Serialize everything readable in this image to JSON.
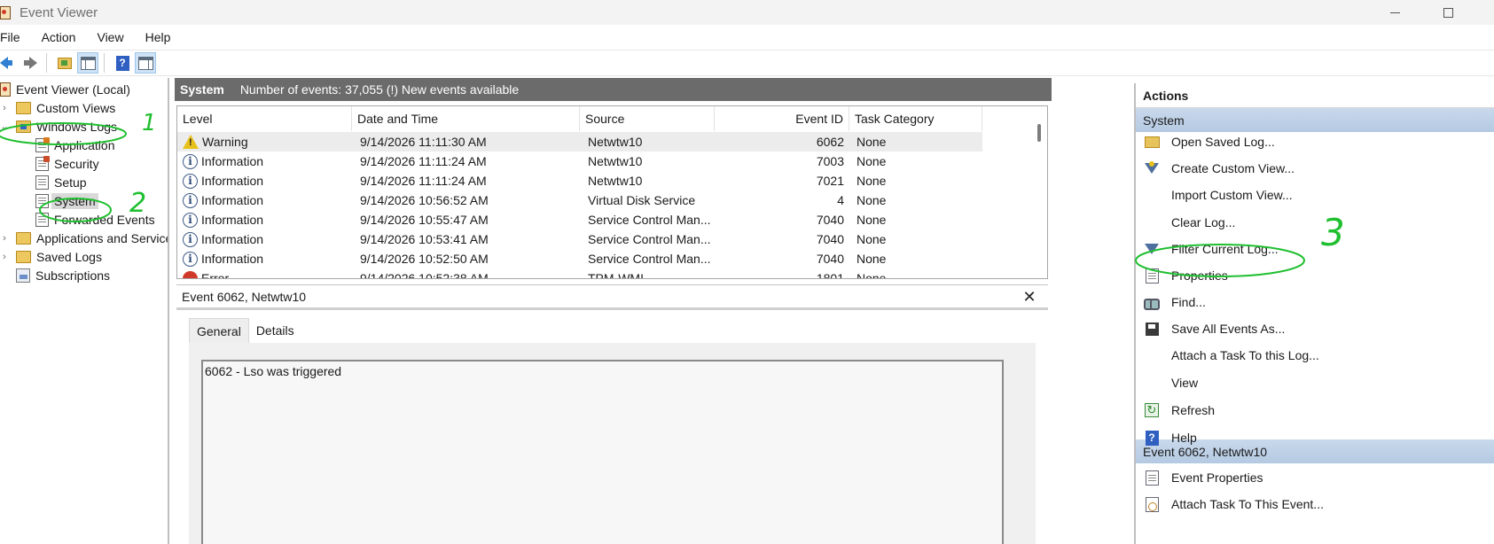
{
  "window": {
    "title": "Event Viewer"
  },
  "menu": [
    "File",
    "Action",
    "View",
    "Help"
  ],
  "toolbar": {
    "buttons": [
      "back-arrow-icon",
      "forward-arrow-icon",
      "folder-up-icon",
      "show-hide-console-tree-icon",
      "help-icon",
      "show-hide-action-pane-icon"
    ]
  },
  "tree": {
    "root": "Event Viewer (Local)",
    "custom_views": "Custom Views",
    "windows_logs": "Windows Logs",
    "application": "Application",
    "security": "Security",
    "setup": "Setup",
    "system": "System",
    "forwarded_events": "Forwarded Events",
    "apps_services": "Applications and Services",
    "saved_logs": "Saved Logs",
    "subscriptions": "Subscriptions",
    "selected": "System"
  },
  "log_header": {
    "log_name": "System",
    "summary": "Number of events: 37,055 (!) New events available"
  },
  "grid": {
    "columns": [
      "Level",
      "Date and Time",
      "Source",
      "Event ID",
      "Task Category"
    ],
    "rows": [
      {
        "level": "Warning",
        "icon": "warning-icon",
        "date": "9/14/2026 11:11:30 AM",
        "source": "Netwtw10",
        "id": "6062",
        "task": "None"
      },
      {
        "level": "Information",
        "icon": "info-icon",
        "date": "9/14/2026 11:11:24 AM",
        "source": "Netwtw10",
        "id": "7003",
        "task": "None"
      },
      {
        "level": "Information",
        "icon": "info-icon",
        "date": "9/14/2026 11:11:24 AM",
        "source": "Netwtw10",
        "id": "7021",
        "task": "None"
      },
      {
        "level": "Information",
        "icon": "info-icon",
        "date": "9/14/2026 10:56:52 AM",
        "source": "Virtual Disk Service",
        "id": "4",
        "task": "None"
      },
      {
        "level": "Information",
        "icon": "info-icon",
        "date": "9/14/2026 10:55:47 AM",
        "source": "Service Control Man...",
        "id": "7040",
        "task": "None"
      },
      {
        "level": "Information",
        "icon": "info-icon",
        "date": "9/14/2026 10:53:41 AM",
        "source": "Service Control Man...",
        "id": "7040",
        "task": "None"
      },
      {
        "level": "Information",
        "icon": "info-icon",
        "date": "9/14/2026 10:52:50 AM",
        "source": "Service Control Man...",
        "id": "7040",
        "task": "None"
      },
      {
        "level": "Error",
        "icon": "error-icon",
        "date": "9/14/2026 10:52:38 AM",
        "source": "TPM-WMI",
        "id": "1801",
        "task": "None"
      }
    ]
  },
  "detail": {
    "title": "Event 6062, Netwtw10",
    "tabs": [
      "General",
      "Details"
    ],
    "description": "6062 - Lso was triggered"
  },
  "actions": {
    "title": "Actions",
    "section1": "System",
    "items1": [
      {
        "label": "Open Saved Log...",
        "icon": "open-folder-icon"
      },
      {
        "label": "Create Custom View...",
        "icon": "filter-star-icon"
      },
      {
        "label": "Import Custom View...",
        "icon": ""
      },
      {
        "label": "Clear Log...",
        "icon": ""
      },
      {
        "label": "Filter Current Log...",
        "icon": "filter-icon"
      },
      {
        "label": "Properties",
        "icon": "properties-icon"
      },
      {
        "label": "Find...",
        "icon": "binoculars-icon"
      },
      {
        "label": "Save All Events As...",
        "icon": "save-icon"
      },
      {
        "label": "Attach a Task To this Log...",
        "icon": ""
      },
      {
        "label": "View",
        "icon": ""
      },
      {
        "label": "Refresh",
        "icon": "refresh-icon"
      },
      {
        "label": "Help",
        "icon": "help-icon"
      }
    ],
    "section2": "Event 6062, Netwtw10",
    "items2": [
      {
        "label": "Event Properties",
        "icon": "properties-icon"
      },
      {
        "label": "Attach Task To This Event...",
        "icon": "task-clock-icon"
      }
    ]
  },
  "annotations": {
    "color": "#1fbf2f",
    "labels": [
      "1",
      "2",
      "3"
    ]
  }
}
